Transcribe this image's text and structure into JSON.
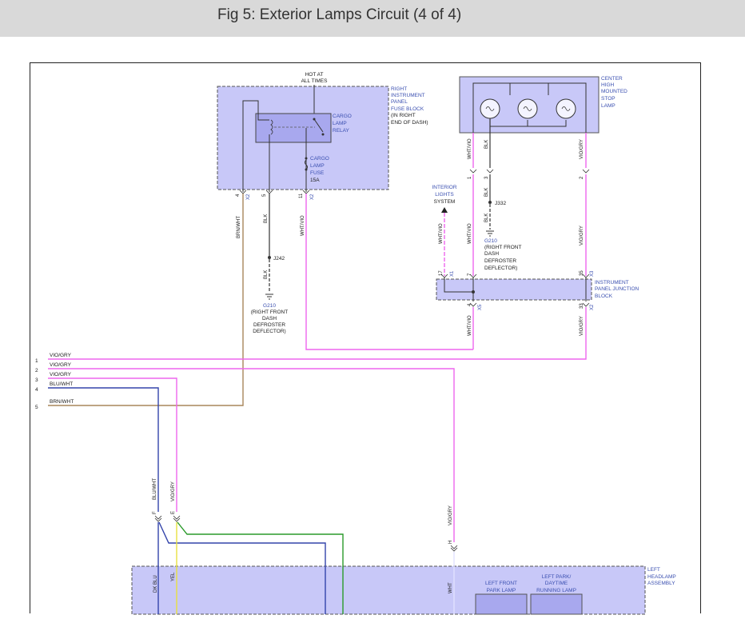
{
  "header": {
    "title": "Fig 5: Exterior Lamps Circuit (4 of 4)"
  },
  "fuse_block": {
    "hot_label_1": "HOT AT",
    "hot_label_2": "ALL TIMES",
    "name_lines": [
      "RIGHT",
      "INSTRUMENT",
      "PANEL",
      "FUSE BLOCK",
      "(IN RIGHT",
      "END OF DASH)"
    ],
    "relay_lines": [
      "CARGO",
      "LAMP",
      "RELAY"
    ],
    "fuse_lines": [
      "CARGO",
      "LAMP",
      "FUSE",
      "15A"
    ],
    "pin_4": "4",
    "pin_5": "5",
    "pin_11": "11",
    "conn_x2": "X2",
    "conn_x2b": "X2"
  },
  "wires_left": {
    "brn_wht": "BRN/WHT",
    "blk": "BLK",
    "wht_vio": "WHT/VIO",
    "blk2": "BLK",
    "splice_j242": "J242",
    "ground_lines": [
      "G210",
      "(RIGHT FRONT",
      "DASH",
      "DEFROSTER",
      "DEFLECTOR)"
    ]
  },
  "stop_lamp": {
    "name_lines": [
      "CENTER",
      "HIGH",
      "MOUNTED",
      "STOP",
      "LAMP"
    ],
    "wire_wht_vio": "WHT/VIO",
    "wire_blk": "BLK",
    "wire_vio_gry": "VIO/GRY",
    "pin_1": "1",
    "pin_3": "3",
    "pin_2": "2",
    "wire_blk2": "BLK",
    "splice_j332": "J332",
    "wire_blk3": "BLK",
    "ground_lines": [
      "G210",
      "(RIGHT FRONT",
      "DASH",
      "DEFROSTER",
      "DEFLECTOR)"
    ]
  },
  "interior_lights": {
    "lines": [
      "INTERIOR",
      "LIGHTS",
      "SYSTEM"
    ],
    "wire_wht_vio": "WHT/VIO"
  },
  "junction_block": {
    "name_lines": [
      "INSTRUMENT",
      "PANEL JUNCTION",
      "BLOCK"
    ],
    "wire_wht_vio_in": "WHT/VIO",
    "wire_vio_gry_in": "VIO/GRY",
    "pin_17": "17",
    "pin_7": "7",
    "pin_35": "35",
    "pin_4": "4",
    "pin_33": "33",
    "conn_x1": "X1",
    "conn_x3": "X3",
    "conn_x5": "X5",
    "conn_x2": "X2",
    "wire_wht_vio_out": "WHT/VIO",
    "wire_vio_gry_out": "VIO/GRY"
  },
  "harness": [
    {
      "num": "1",
      "label": "VIO/GRY"
    },
    {
      "num": "2",
      "label": "VIO/GRY"
    },
    {
      "num": "3",
      "label": "VIO/GRY"
    },
    {
      "num": "4",
      "label": "BLU/WHT"
    },
    {
      "num": "5",
      "label": "BRN/WHT"
    }
  ],
  "lower": {
    "wire_blu_wht": "BLU/WHT",
    "wire_vio_gry": "VIO/GRY",
    "wire_vio_gry_right": "VIO/GRY",
    "pin_f": "F",
    "pin_e": "E",
    "pin_h": "H",
    "wire_dk_blu": "DK BLU",
    "wire_yel": "YEL",
    "wire_wht": "WHT",
    "headlamp_lines": [
      "LEFT",
      "HEADLAMP",
      "ASSEMBLY"
    ],
    "park_lamp_lines": [
      "LEFT FRONT",
      "PARK LAMP"
    ],
    "drl_lines": [
      "LEFT PARK/",
      "DAYTIME",
      "RUNNING LAMP"
    ]
  },
  "colors": {
    "pink": "#ee66ee",
    "brown": "#a8865a",
    "blue": "#3344aa",
    "yellow": "#e8e040",
    "green": "#2a9a2a",
    "box_fill": "#c8c8f8",
    "box_fill_dark": "#a8a8ee",
    "label_blue": "#3a4fb0"
  }
}
